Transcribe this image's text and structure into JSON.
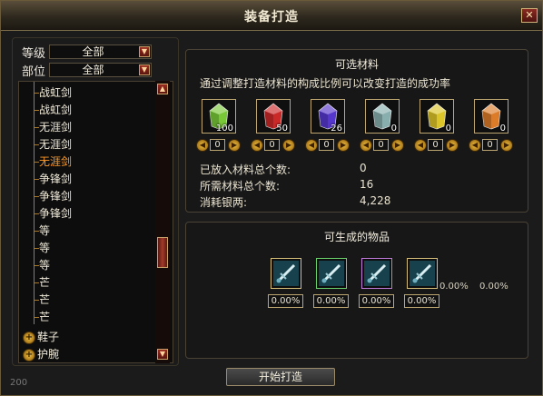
{
  "window": {
    "title": "装备打造",
    "close_glyph": "✕"
  },
  "filters": {
    "level": {
      "label": "等级",
      "value": "全部"
    },
    "slot": {
      "label": "部位",
      "value": "全部"
    }
  },
  "tree_items": [
    {
      "label": "战虹剑"
    },
    {
      "label": "战虹剑"
    },
    {
      "label": "无涯剑"
    },
    {
      "label": "无涯剑"
    },
    {
      "label": "无涯剑",
      "selected": true
    },
    {
      "label": "争锋剑"
    },
    {
      "label": "争锋剑"
    },
    {
      "label": "争锋剑"
    },
    {
      "label": "等"
    },
    {
      "label": "等"
    },
    {
      "label": "等"
    },
    {
      "label": "芒"
    },
    {
      "label": "芒"
    },
    {
      "label": "芒"
    }
  ],
  "tree_groups": [
    {
      "label": "鞋子"
    },
    {
      "label": "护腕"
    }
  ],
  "materials_panel": {
    "title": "可选材料",
    "description": "通过调整打造材料的构成比例可以改变打造的成功率",
    "materials": [
      {
        "name": "green-crystal",
        "color": "#7fd23a",
        "count": "100",
        "amount": "0"
      },
      {
        "name": "red-crystal",
        "color": "#d62a2a",
        "count": "50",
        "amount": "0"
      },
      {
        "name": "purple-crystal",
        "color": "#5a3ad8",
        "count": "26",
        "amount": "0"
      },
      {
        "name": "gray-crystal",
        "color": "#8fb7b7",
        "count": "0",
        "amount": "0"
      },
      {
        "name": "yellow-crystal",
        "color": "#e8cf2a",
        "count": "0",
        "amount": "0"
      },
      {
        "name": "orange-crystal",
        "color": "#e9822a",
        "count": "0",
        "amount": "0"
      }
    ],
    "stats": [
      {
        "label": "已放入材料总个数:",
        "value": "0"
      },
      {
        "label": "所需材料总个数:",
        "value": "16"
      },
      {
        "label": "消耗银两:",
        "value": "4,228"
      }
    ]
  },
  "products_panel": {
    "title": "可生成的物品",
    "items": [
      {
        "name": "product-weapon-white",
        "rarity": "white",
        "rate": "0.00%"
      },
      {
        "name": "product-weapon-green",
        "rarity": "green",
        "rate": "0.00%"
      },
      {
        "name": "product-weapon-purple",
        "rarity": "purple",
        "rate": "0.00%"
      },
      {
        "name": "product-weapon-gold",
        "rarity": "white",
        "rate": "0.00%"
      }
    ],
    "extra_rates": [
      "0.00%",
      "0.00%"
    ]
  },
  "start_button": "开始打造",
  "footer_number": "200"
}
